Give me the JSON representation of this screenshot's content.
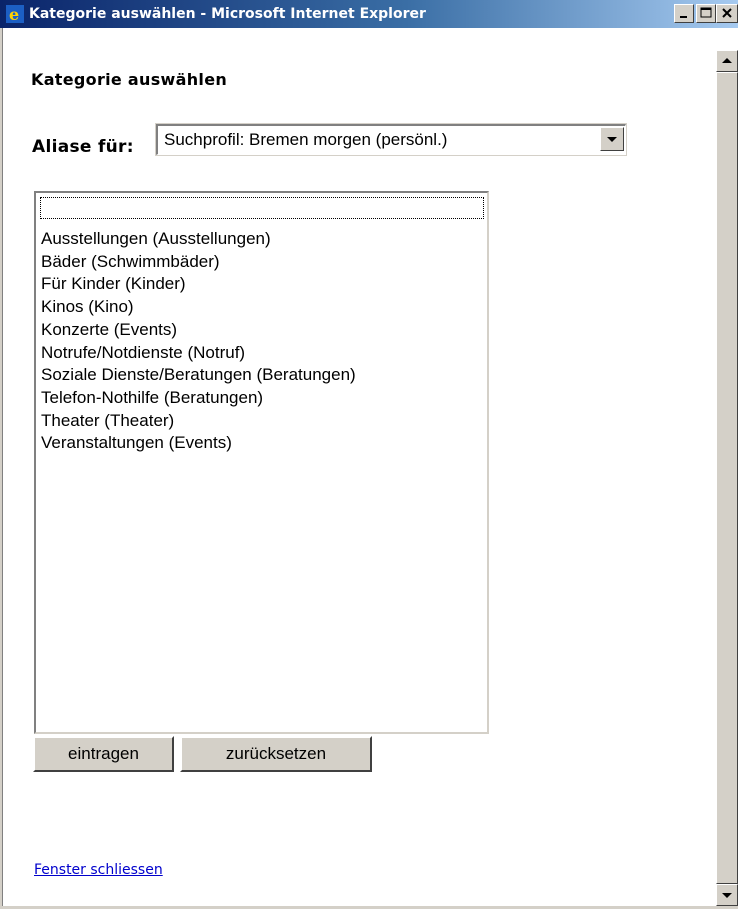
{
  "window": {
    "title": "Kategorie auswählen - Microsoft Internet Explorer",
    "icon": "internet-explorer-icon",
    "controls": [
      "minimize-icon",
      "maximize-icon",
      "close-icon"
    ]
  },
  "page": {
    "heading": "Kategorie auswählen",
    "alias_label": "Aliase für:",
    "alias_select_value": "Suchprofil: Bremen morgen (persönl.)",
    "category_list": [
      "",
      "Ausstellungen (Ausstellungen)",
      "Bäder (Schwimmbäder)",
      "Für Kinder (Kinder)",
      "Kinos (Kino)",
      "Konzerte (Events)",
      "Notrufe/Notdienste (Notruf)",
      "Soziale Dienste/Beratungen (Beratungen)",
      "Telefon-Nothilfe (Beratungen)",
      "Theater (Theater)",
      "Veranstaltungen (Events)"
    ],
    "submit_label": "eintragen",
    "reset_label": "zurücksetzen",
    "close_link": "Fenster schliessen"
  },
  "colors": {
    "titlebar_start": "#0a246a",
    "titlebar_end": "#a6caf0",
    "button_face": "#d4d0c8",
    "link": "#0000cc"
  }
}
